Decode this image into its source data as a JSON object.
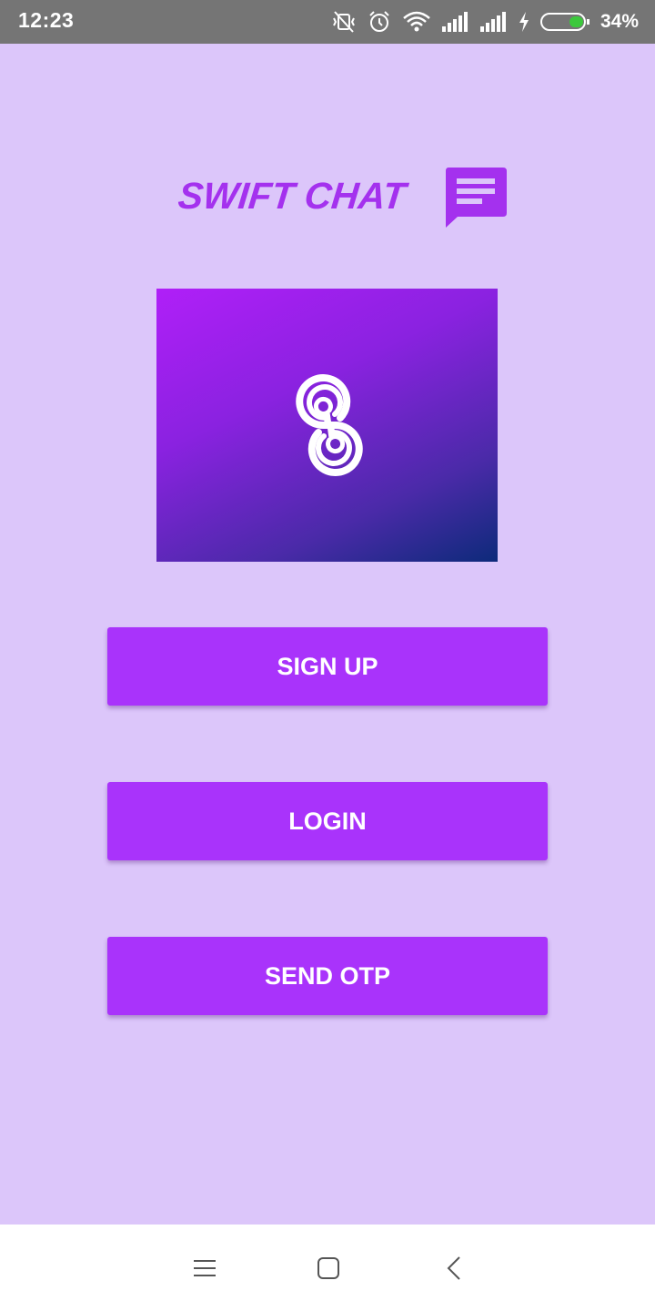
{
  "status_bar": {
    "time": "12:23",
    "battery_percent": "34%",
    "battery_level": 0.34,
    "icons": [
      "vibrate-off-icon",
      "alarm-icon",
      "wifi-icon",
      "signal-icon",
      "signal-icon",
      "charging-icon",
      "battery-icon"
    ]
  },
  "header": {
    "title": "SWIFT CHAT",
    "icon": "chat-message-icon"
  },
  "logo": {
    "icon": "s-logo-icon"
  },
  "buttons": {
    "signup": "SIGN UP",
    "login": "LOGIN",
    "send_otp": "SEND OTP"
  },
  "nav_bar": {
    "icons": [
      "menu-icon",
      "home-icon",
      "back-icon"
    ]
  },
  "colors": {
    "background": "#dcc6fa",
    "accent": "#a933fb",
    "title": "#a431ee",
    "status_bar": "#757575",
    "battery_fill": "#3cc83c"
  }
}
